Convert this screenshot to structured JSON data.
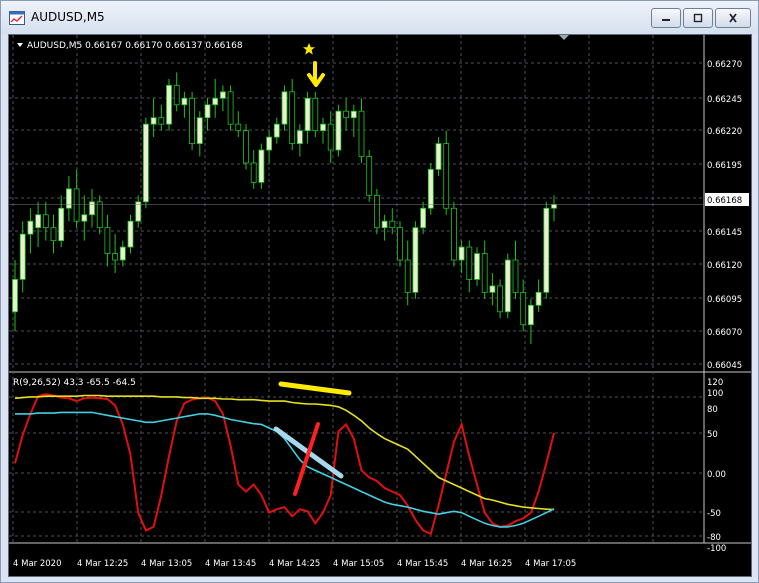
{
  "window": {
    "title": "AUDUSD,M5",
    "icon": "chart-window-icon",
    "controls": [
      "minimize-icon",
      "maximize-icon",
      "close-icon"
    ]
  },
  "colors": {
    "background": "#000000",
    "grid": "#4a4f5a",
    "bull_candle": "#e8f0d0",
    "candle_outline": "#1ec21e",
    "price_label_bg": "#ffffff",
    "rsi_red": "#e01010",
    "rsi_yellow": "#e6e020",
    "rsi_cyan": "#40d0e0",
    "annotation_yellow": "#ffea00",
    "annotation_red": "#ff2020",
    "annotation_blue": "#a8d8ee"
  },
  "price_panel": {
    "header": "AUDUSD,M5  0.66167 0.66170 0.66137 0.66168",
    "current_price": "0.66168",
    "price_ticks": [
      "0.66270",
      "0.66245",
      "0.66220",
      "0.66195",
      "0.66145",
      "0.66120",
      "0.66095",
      "0.66070",
      "0.66045"
    ],
    "annotations": [
      "star-icon",
      "down-arrow-icon"
    ]
  },
  "indicator_panel": {
    "header": "R(9,26,52) 43.3 -65.5 -64.5",
    "ticks": [
      "120",
      "100",
      "80",
      "50",
      "0.00",
      "-50",
      "-80",
      "-100"
    ]
  },
  "time_axis": [
    "4 Mar 2020",
    "4 Mar 12:25",
    "4 Mar 13:05",
    "4 Mar 13:45",
    "4 Mar 14:25",
    "4 Mar 15:05",
    "4 Mar 15:45",
    "4 Mar 16:25",
    "4 Mar 17:05"
  ],
  "chart_data": [
    {
      "type": "candlestick",
      "symbol": "AUDUSD",
      "timeframe": "M5",
      "ylim": [
        0.6604,
        0.66285
      ],
      "candles": [
        [
          0.66085,
          0.66125,
          0.6607,
          0.6611
        ],
        [
          0.6611,
          0.66155,
          0.661,
          0.66145
        ],
        [
          0.66145,
          0.66165,
          0.6613,
          0.66155
        ],
        [
          0.6615,
          0.6617,
          0.66135,
          0.6616
        ],
        [
          0.6616,
          0.6617,
          0.6614,
          0.6615
        ],
        [
          0.6615,
          0.6616,
          0.6613,
          0.6614
        ],
        [
          0.6614,
          0.66175,
          0.66135,
          0.66165
        ],
        [
          0.66165,
          0.6619,
          0.66155,
          0.6618
        ],
        [
          0.6618,
          0.66195,
          0.6615,
          0.66155
        ],
        [
          0.66155,
          0.66175,
          0.6614,
          0.6616
        ],
        [
          0.6616,
          0.6618,
          0.6615,
          0.6617
        ],
        [
          0.6617,
          0.66175,
          0.66145,
          0.6615
        ],
        [
          0.6615,
          0.6616,
          0.6612,
          0.6613
        ],
        [
          0.6613,
          0.66145,
          0.66115,
          0.66125
        ],
        [
          0.66125,
          0.6614,
          0.6612,
          0.66135
        ],
        [
          0.66135,
          0.6616,
          0.6613,
          0.66155
        ],
        [
          0.66155,
          0.66175,
          0.6615,
          0.6617
        ],
        [
          0.6617,
          0.66235,
          0.66165,
          0.6623
        ],
        [
          0.6623,
          0.6625,
          0.6622,
          0.66235
        ],
        [
          0.66235,
          0.66245,
          0.66225,
          0.6623
        ],
        [
          0.6623,
          0.66265,
          0.66225,
          0.6626
        ],
        [
          0.6626,
          0.6627,
          0.6624,
          0.66245
        ],
        [
          0.66245,
          0.66255,
          0.66235,
          0.6625
        ],
        [
          0.6625,
          0.66255,
          0.6621,
          0.66215
        ],
        [
          0.66215,
          0.6624,
          0.66205,
          0.66235
        ],
        [
          0.66235,
          0.6625,
          0.66225,
          0.66245
        ],
        [
          0.66245,
          0.66265,
          0.66235,
          0.6625
        ],
        [
          0.6625,
          0.6626,
          0.6624,
          0.66255
        ],
        [
          0.66255,
          0.6626,
          0.66225,
          0.6623
        ],
        [
          0.6623,
          0.6624,
          0.6622,
          0.66225
        ],
        [
          0.66225,
          0.6623,
          0.66195,
          0.662
        ],
        [
          0.662,
          0.6621,
          0.6618,
          0.66185
        ],
        [
          0.66185,
          0.66215,
          0.6618,
          0.6621
        ],
        [
          0.6621,
          0.66225,
          0.662,
          0.6622
        ],
        [
          0.6622,
          0.66235,
          0.66215,
          0.6623
        ],
        [
          0.6623,
          0.6626,
          0.66225,
          0.66255
        ],
        [
          0.66255,
          0.66265,
          0.6621,
          0.66215
        ],
        [
          0.66215,
          0.6623,
          0.66205,
          0.66225
        ],
        [
          0.66225,
          0.66255,
          0.66215,
          0.6625
        ],
        [
          0.6625,
          0.66255,
          0.6622,
          0.66225
        ],
        [
          0.66225,
          0.66235,
          0.66215,
          0.6623
        ],
        [
          0.6623,
          0.6624,
          0.662,
          0.6621
        ],
        [
          0.6621,
          0.66245,
          0.66205,
          0.6624
        ],
        [
          0.6624,
          0.6625,
          0.66225,
          0.66235
        ],
        [
          0.66235,
          0.66245,
          0.6622,
          0.6624
        ],
        [
          0.6624,
          0.6625,
          0.662,
          0.66205
        ],
        [
          0.66205,
          0.6621,
          0.6617,
          0.66175
        ],
        [
          0.66175,
          0.6618,
          0.66145,
          0.6615
        ],
        [
          0.6615,
          0.6616,
          0.6614,
          0.66155
        ],
        [
          0.66155,
          0.66165,
          0.66145,
          0.6615
        ],
        [
          0.6615,
          0.66155,
          0.6612,
          0.66125
        ],
        [
          0.66125,
          0.6614,
          0.6609,
          0.661
        ],
        [
          0.661,
          0.66155,
          0.66095,
          0.6615
        ],
        [
          0.6615,
          0.6617,
          0.66145,
          0.66165
        ],
        [
          0.66165,
          0.662,
          0.6616,
          0.66195
        ],
        [
          0.66195,
          0.6622,
          0.6619,
          0.66215
        ],
        [
          0.66215,
          0.66225,
          0.6616,
          0.66165
        ],
        [
          0.66165,
          0.6617,
          0.6612,
          0.66125
        ],
        [
          0.66125,
          0.6614,
          0.66115,
          0.66135
        ],
        [
          0.66135,
          0.6614,
          0.661,
          0.6611
        ],
        [
          0.6611,
          0.66135,
          0.66105,
          0.6613
        ],
        [
          0.6613,
          0.6614,
          0.66095,
          0.661
        ],
        [
          0.661,
          0.66115,
          0.6609,
          0.66105
        ],
        [
          0.66105,
          0.6611,
          0.6608,
          0.66085
        ],
        [
          0.66085,
          0.6613,
          0.6608,
          0.66125
        ],
        [
          0.66125,
          0.6614,
          0.66095,
          0.661
        ],
        [
          0.661,
          0.6611,
          0.6607,
          0.66075
        ],
        [
          0.66075,
          0.66095,
          0.6606,
          0.6609
        ],
        [
          0.6609,
          0.6611,
          0.66085,
          0.661
        ],
        [
          0.661,
          0.6617,
          0.66095,
          0.66165
        ],
        [
          0.66165,
          0.66175,
          0.66155,
          0.66168
        ]
      ]
    },
    {
      "type": "line",
      "title": "R(9,26,52)",
      "ylim": [
        -110,
        125
      ],
      "series": [
        {
          "name": "43.3",
          "color": "#e01010",
          "values": [
            0,
            40,
            70,
            95,
            98,
            96,
            93,
            92,
            88,
            92,
            93,
            92,
            91,
            82,
            55,
            12,
            -70,
            -95,
            -90,
            -45,
            10,
            60,
            85,
            90,
            92,
            93,
            88,
            70,
            25,
            -30,
            -40,
            -30,
            -45,
            -70,
            -65,
            -62,
            -75,
            -65,
            -68,
            -85,
            -70,
            -45,
            45,
            55,
            35,
            -10,
            -20,
            -25,
            -35,
            -40,
            -45,
            -60,
            -80,
            -95,
            -100,
            -60,
            -15,
            30,
            55,
            10,
            -30,
            -70,
            -85,
            -90,
            -88,
            -82,
            -78,
            -70,
            -40,
            0,
            43
          ]
        },
        {
          "name": "-65.5",
          "color": "#e6e020",
          "values": [
            92,
            93,
            94,
            94,
            95,
            95,
            95,
            95,
            95,
            96,
            96,
            96,
            95,
            95,
            95,
            95,
            95,
            95,
            95,
            94,
            94,
            94,
            93,
            93,
            92,
            92,
            92,
            91,
            91,
            90,
            90,
            90,
            89,
            88,
            88,
            88,
            86,
            85,
            84,
            84,
            83,
            82,
            80,
            75,
            68,
            60,
            50,
            42,
            35,
            30,
            25,
            20,
            10,
            0,
            -10,
            -20,
            -25,
            -30,
            -35,
            -40,
            -45,
            -50,
            -52,
            -55,
            -58,
            -60,
            -62,
            -63,
            -64,
            -65,
            -65.5
          ]
        },
        {
          "name": "-64.5",
          "color": "#40d0e0",
          "values": [
            70,
            70,
            70,
            71,
            71,
            71,
            72,
            72,
            72,
            72,
            72,
            70,
            68,
            66,
            64,
            62,
            60,
            58,
            58,
            60,
            62,
            64,
            66,
            68,
            70,
            70,
            68,
            65,
            62,
            60,
            58,
            56,
            55,
            50,
            45,
            35,
            20,
            5,
            -5,
            -10,
            -15,
            -20,
            -25,
            -30,
            -35,
            -40,
            -45,
            -50,
            -55,
            -58,
            -60,
            -62,
            -65,
            -68,
            -70,
            -72,
            -70,
            -68,
            -70,
            -75,
            -80,
            -85,
            -88,
            -90,
            -90,
            -88,
            -85,
            -80,
            -75,
            -70,
            -64.5
          ]
        }
      ]
    }
  ]
}
